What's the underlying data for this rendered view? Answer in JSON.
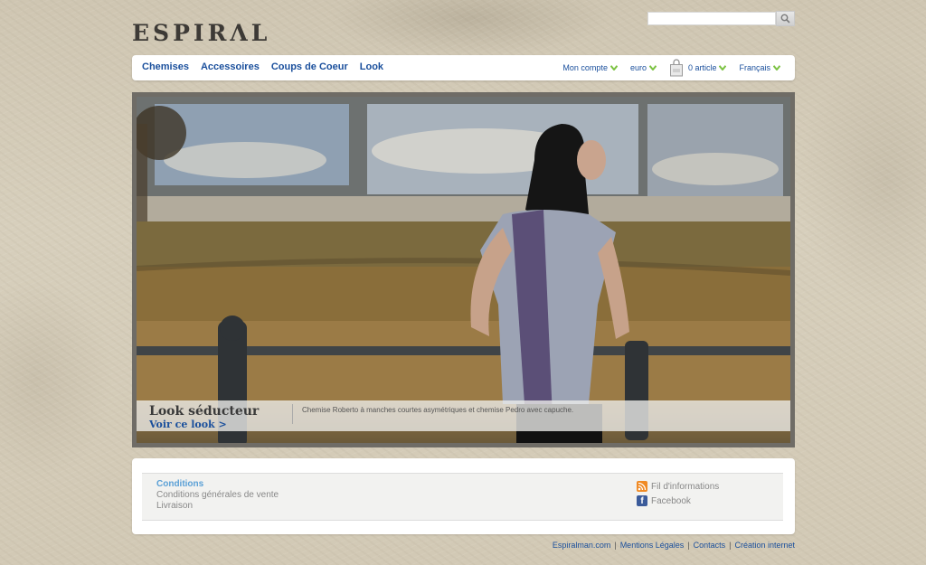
{
  "brand": {
    "logo_text": "ESPIRΛL"
  },
  "search": {
    "placeholder": "",
    "value": ""
  },
  "nav": {
    "left": [
      "Chemises",
      "Accessoires",
      "Coups de Coeur",
      "Look"
    ],
    "account_label": "Mon compte",
    "currency_label": "euro",
    "cart_label": "0 article",
    "language_label": "Français"
  },
  "hero": {
    "title": "Look séducteur",
    "link": "Voir ce look >",
    "description": "Chemise Roberto à manches courtes asymétriques et chemise Pedro avec capuche."
  },
  "footer": {
    "conditions_heading": "Conditions",
    "conditions_items": [
      "Conditions générales de vente",
      "Livraison"
    ],
    "social": {
      "rss": "Fil d'informations",
      "facebook": "Facebook"
    },
    "bottom_links": [
      "Espiralman.com",
      "Mentions Légales",
      "Contacts",
      "Création internet"
    ],
    "separator": "|"
  },
  "colors": {
    "link": "#1a4f9c",
    "chevron": "#7cc242",
    "conditions_heading": "#5aa0d6",
    "rss": "#f08a24",
    "facebook": "#3b5b9a"
  }
}
